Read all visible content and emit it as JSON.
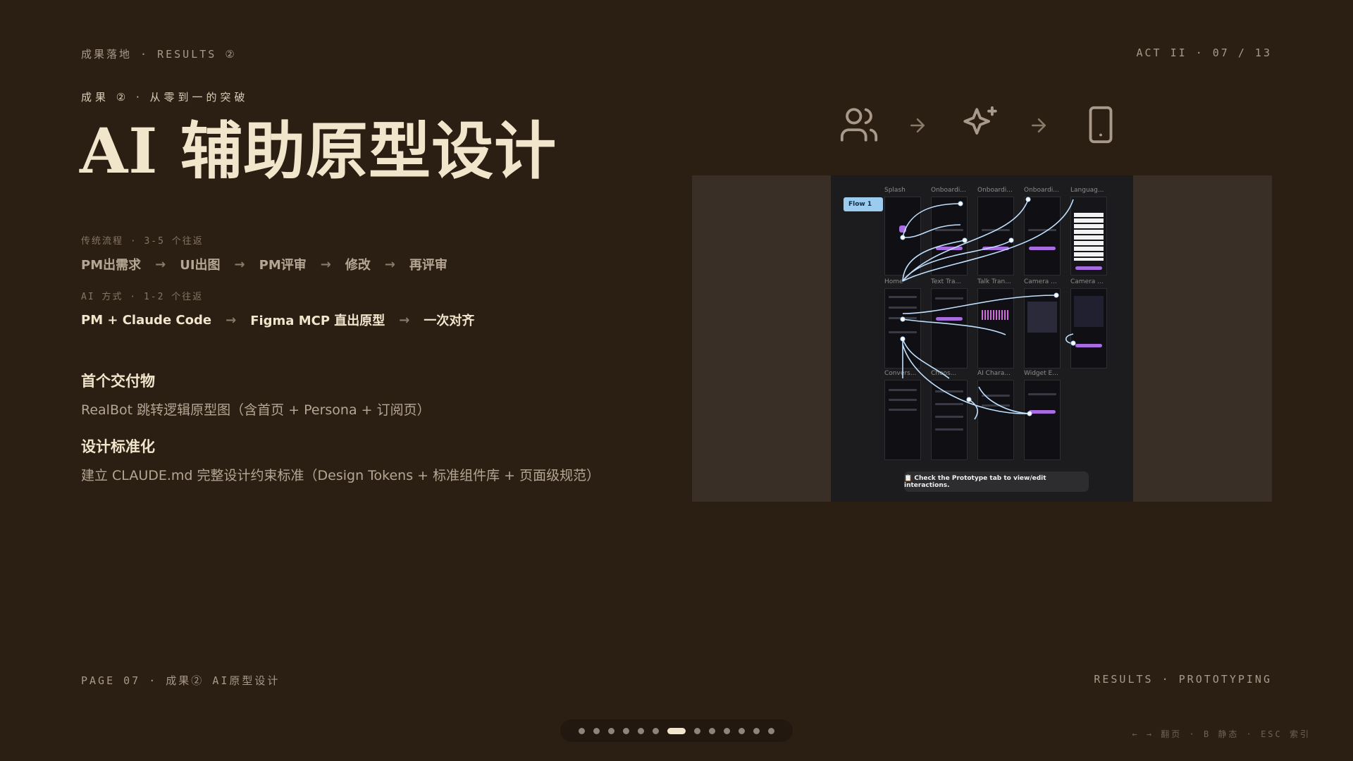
{
  "header": {
    "section_label": "成果落地 · RESULTS ②",
    "act_counter": "ACT II · 07 / 13"
  },
  "kicker": "成果 ② · 从零到一的突破",
  "headline": "AI 辅助原型设计",
  "traditional_flow": {
    "label": "传统流程 · 3-5 个往返",
    "steps": [
      "PM出需求",
      "UI出图",
      "PM评审",
      "修改",
      "再评审"
    ]
  },
  "ai_flow": {
    "label": "AI 方式 · 1-2 个往返",
    "steps": [
      "PM + Claude Code",
      "Figma MCP 直出原型",
      "一次对齐"
    ]
  },
  "sections": [
    {
      "title": "首个交付物",
      "body": "RealBot 跳转逻辑原型图（含首页 + Persona + 订阅页）"
    },
    {
      "title": "设计标准化",
      "body": "建立 CLAUDE.md 完整设计约束标准（Design Tokens + 标准组件库 + 页面级规范）"
    }
  ],
  "icons": [
    "users-icon",
    "arrow-right-icon",
    "sparkles-icon",
    "arrow-right-icon",
    "smartphone-icon"
  ],
  "prototype": {
    "flow_tag": "Flow 1",
    "screen_labels": [
      "Splash",
      "Onboardi...",
      "Onboardi...",
      "Onboardi...",
      "Languag...",
      "Home",
      "Text Tra...",
      "Talk Tran...",
      "Camera ...",
      "Camera ...",
      "Convers...",
      "Choos...",
      "AI Chara...",
      "Widget E..."
    ],
    "note": "📋 Check the Prototype tab to view/edit interactions."
  },
  "footer": {
    "page_label": "PAGE 07 · 成果② AI原型设计",
    "topic": "RESULTS · PROTOTYPING",
    "keyboard_hint": "← → 翻页 · B 静态 · ESC 索引"
  },
  "pagination": {
    "total": 13,
    "current": 7
  },
  "colors": {
    "background": "#2b1f14",
    "headline": "#f1e5cc",
    "muted": "#a8998a",
    "wire": "#bfe0ff"
  }
}
